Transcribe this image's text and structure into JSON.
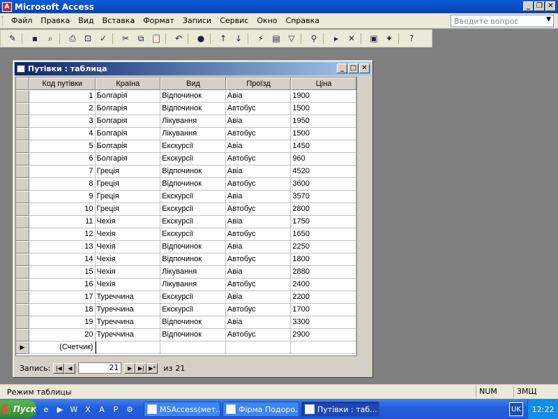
{
  "app": {
    "title": "Microsoft Access"
  },
  "menu": [
    "Файл",
    "Правка",
    "Вид",
    "Вставка",
    "Формат",
    "Записи",
    "Сервис",
    "Окно",
    "Справка"
  ],
  "ask": {
    "placeholder": "Введите вопрос"
  },
  "table_window": {
    "title": "Путівки : таблица"
  },
  "table": {
    "headers": [
      "Код путівки",
      "Країна",
      "Вид",
      "Проїзд",
      "Ціна"
    ],
    "rows": [
      [
        "1",
        "Болгарія",
        "Відпочинок",
        "Авіа",
        "1900"
      ],
      [
        "2",
        "Болгарія",
        "Відпочинок",
        "Автобус",
        "1500"
      ],
      [
        "3",
        "Болгарія",
        "Лікування",
        "Авіа",
        "1950"
      ],
      [
        "4",
        "Болгарія",
        "Лікування",
        "Автобус",
        "1500"
      ],
      [
        "5",
        "Болгарія",
        "Екскурсії",
        "Авіа",
        "1450"
      ],
      [
        "6",
        "Болгарія",
        "Екскурсії",
        "Автобус",
        "960"
      ],
      [
        "7",
        "Греція",
        "Відпочинок",
        "Авіа",
        "4520"
      ],
      [
        "8",
        "Греція",
        "Відпочинок",
        "Автобус",
        "3600"
      ],
      [
        "9",
        "Греція",
        "Екскурсії",
        "Авіа",
        "3570"
      ],
      [
        "10",
        "Греція",
        "Екскурсії",
        "Автобус",
        "2800"
      ],
      [
        "11",
        "Чехія",
        "Екскурсії",
        "Авіа",
        "1750"
      ],
      [
        "12",
        "Чехія",
        "Екскурсії",
        "Автобус",
        "1650"
      ],
      [
        "13",
        "Чехія",
        "Відпочинок",
        "Авіа",
        "2250"
      ],
      [
        "14",
        "Чехія",
        "Відпочинок",
        "Автобус",
        "1800"
      ],
      [
        "15",
        "Чехія",
        "Лікування",
        "Авіа",
        "2880"
      ],
      [
        "16",
        "Чехія",
        "Лікування",
        "Автобус",
        "2400"
      ],
      [
        "17",
        "Туреччина",
        "Екскурсії",
        "Авіа",
        "2200"
      ],
      [
        "18",
        "Туреччина",
        "Екскурсії",
        "Автобус",
        "1700"
      ],
      [
        "19",
        "Туреччина",
        "Відпочинок",
        "Авіа",
        "3300"
      ],
      [
        "20",
        "Туреччина",
        "Відпочинок",
        "Автобус",
        "2900"
      ]
    ],
    "new_row_label": "(Счетчик)"
  },
  "nav": {
    "label": "Запись:",
    "current": "21",
    "of_label": "из",
    "total": "21"
  },
  "status": {
    "text": "Режим таблицы",
    "num": "NUM",
    "zmsc": "ЗМЩ"
  },
  "taskbar": {
    "start": "Пуск",
    "tasks": [
      "MSAccess(мет...",
      "Фірма Подоро...",
      "Путівки : таб..."
    ],
    "lang": "UK",
    "clock": "12:22"
  }
}
